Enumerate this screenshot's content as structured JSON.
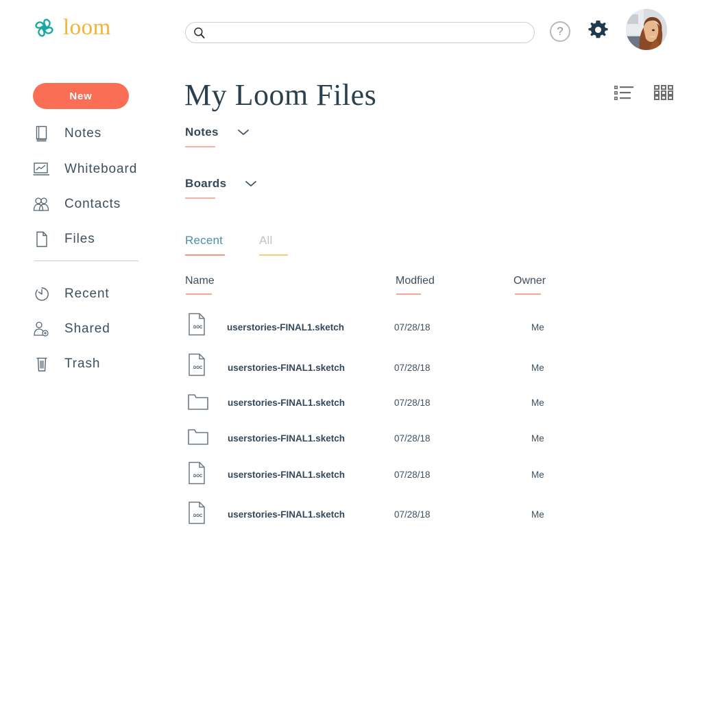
{
  "brand": {
    "name": "loom",
    "logo_icon": "loom-knot-logo",
    "logo_color": "#17A8A0",
    "word_color": "#F5B335"
  },
  "header": {
    "search": {
      "value": "",
      "placeholder": "",
      "icon": "search-icon"
    },
    "help": {
      "label": "?",
      "icon": "help-circle-icon"
    },
    "settings": {
      "icon": "gear-icon",
      "color": "#1F3A4D"
    },
    "avatar": {
      "icon": "user-avatar"
    }
  },
  "sidebar": {
    "new_button": {
      "label": "New",
      "color": "#FA6E55"
    },
    "primary_items": [
      {
        "label": "Notes",
        "icon": "notebook-icon"
      },
      {
        "label": "Whiteboard",
        "icon": "whiteboard-icon"
      },
      {
        "label": "Contacts",
        "icon": "contacts-icon"
      },
      {
        "label": "Files",
        "icon": "file-icon"
      }
    ],
    "secondary_items": [
      {
        "label": "Recent",
        "icon": "clock-icon"
      },
      {
        "label": "Shared",
        "icon": "share-user-icon"
      },
      {
        "label": "Trash",
        "icon": "trash-icon"
      }
    ]
  },
  "main": {
    "title": "My Loom Files",
    "view_toggles": [
      {
        "name": "list-view",
        "icon": "list-view-icon"
      },
      {
        "name": "grid-view",
        "icon": "grid-view-icon"
      }
    ],
    "filters": [
      {
        "label": "Notes",
        "icon": "chevron-down-icon"
      },
      {
        "label": "Boards",
        "icon": "chevron-down-icon"
      }
    ],
    "tabs": [
      {
        "label": "Recent",
        "active": true,
        "underline_color": "#F99484"
      },
      {
        "label": "All",
        "active": false,
        "underline_color": "#F6CE72"
      }
    ],
    "table": {
      "columns": [
        "Name",
        "Modfied",
        "Owner"
      ],
      "rows": [
        {
          "icon": "doc-file-icon",
          "name": "userstories-FINAL1.sketch",
          "modified": "07/28/18",
          "owner": "Me"
        },
        {
          "icon": "doc-file-icon",
          "name": "userstories-FINAL1.sketch",
          "modified": "07/28/18",
          "owner": "Me"
        },
        {
          "icon": "folder-icon",
          "name": "userstories-FINAL1.sketch",
          "modified": "07/28/18",
          "owner": "Me"
        },
        {
          "icon": "folder-icon",
          "name": "userstories-FINAL1.sketch",
          "modified": "07/28/18",
          "owner": "Me"
        },
        {
          "icon": "doc-file-icon",
          "name": "userstories-FINAL1.sketch",
          "modified": "07/28/18",
          "owner": "Me"
        },
        {
          "icon": "doc-file-icon",
          "name": "userstories-FINAL1.sketch",
          "modified": "07/28/18",
          "owner": "Me"
        }
      ]
    }
  }
}
